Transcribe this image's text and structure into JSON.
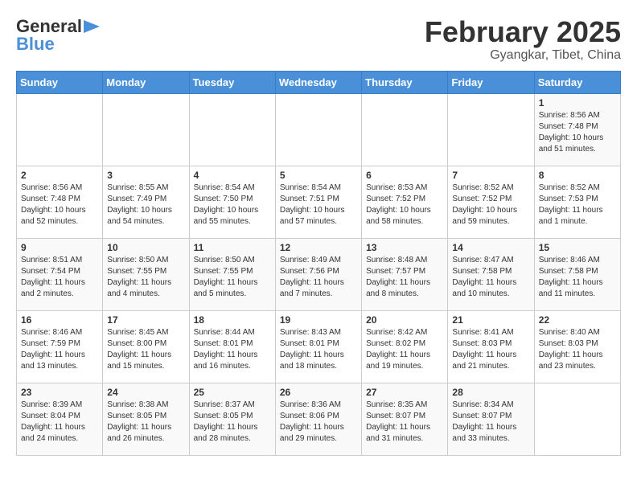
{
  "logo": {
    "text1": "General",
    "text2": "Blue"
  },
  "header": {
    "month": "February 2025",
    "location": "Gyangkar, Tibet, China"
  },
  "weekdays": [
    "Sunday",
    "Monday",
    "Tuesday",
    "Wednesday",
    "Thursday",
    "Friday",
    "Saturday"
  ],
  "weeks": [
    [
      {
        "day": "",
        "info": ""
      },
      {
        "day": "",
        "info": ""
      },
      {
        "day": "",
        "info": ""
      },
      {
        "day": "",
        "info": ""
      },
      {
        "day": "",
        "info": ""
      },
      {
        "day": "",
        "info": ""
      },
      {
        "day": "1",
        "info": "Sunrise: 8:56 AM\nSunset: 7:48 PM\nDaylight: 10 hours\nand 51 minutes."
      }
    ],
    [
      {
        "day": "2",
        "info": "Sunrise: 8:56 AM\nSunset: 7:48 PM\nDaylight: 10 hours\nand 52 minutes."
      },
      {
        "day": "3",
        "info": "Sunrise: 8:55 AM\nSunset: 7:49 PM\nDaylight: 10 hours\nand 54 minutes."
      },
      {
        "day": "4",
        "info": "Sunrise: 8:54 AM\nSunset: 7:50 PM\nDaylight: 10 hours\nand 55 minutes."
      },
      {
        "day": "5",
        "info": "Sunrise: 8:54 AM\nSunset: 7:51 PM\nDaylight: 10 hours\nand 57 minutes."
      },
      {
        "day": "6",
        "info": "Sunrise: 8:53 AM\nSunset: 7:52 PM\nDaylight: 10 hours\nand 58 minutes."
      },
      {
        "day": "7",
        "info": "Sunrise: 8:52 AM\nSunset: 7:52 PM\nDaylight: 10 hours\nand 59 minutes."
      },
      {
        "day": "8",
        "info": "Sunrise: 8:52 AM\nSunset: 7:53 PM\nDaylight: 11 hours\nand 1 minute."
      }
    ],
    [
      {
        "day": "9",
        "info": "Sunrise: 8:51 AM\nSunset: 7:54 PM\nDaylight: 11 hours\nand 2 minutes."
      },
      {
        "day": "10",
        "info": "Sunrise: 8:50 AM\nSunset: 7:55 PM\nDaylight: 11 hours\nand 4 minutes."
      },
      {
        "day": "11",
        "info": "Sunrise: 8:50 AM\nSunset: 7:55 PM\nDaylight: 11 hours\nand 5 minutes."
      },
      {
        "day": "12",
        "info": "Sunrise: 8:49 AM\nSunset: 7:56 PM\nDaylight: 11 hours\nand 7 minutes."
      },
      {
        "day": "13",
        "info": "Sunrise: 8:48 AM\nSunset: 7:57 PM\nDaylight: 11 hours\nand 8 minutes."
      },
      {
        "day": "14",
        "info": "Sunrise: 8:47 AM\nSunset: 7:58 PM\nDaylight: 11 hours\nand 10 minutes."
      },
      {
        "day": "15",
        "info": "Sunrise: 8:46 AM\nSunset: 7:58 PM\nDaylight: 11 hours\nand 11 minutes."
      }
    ],
    [
      {
        "day": "16",
        "info": "Sunrise: 8:46 AM\nSunset: 7:59 PM\nDaylight: 11 hours\nand 13 minutes."
      },
      {
        "day": "17",
        "info": "Sunrise: 8:45 AM\nSunset: 8:00 PM\nDaylight: 11 hours\nand 15 minutes."
      },
      {
        "day": "18",
        "info": "Sunrise: 8:44 AM\nSunset: 8:01 PM\nDaylight: 11 hours\nand 16 minutes."
      },
      {
        "day": "19",
        "info": "Sunrise: 8:43 AM\nSunset: 8:01 PM\nDaylight: 11 hours\nand 18 minutes."
      },
      {
        "day": "20",
        "info": "Sunrise: 8:42 AM\nSunset: 8:02 PM\nDaylight: 11 hours\nand 19 minutes."
      },
      {
        "day": "21",
        "info": "Sunrise: 8:41 AM\nSunset: 8:03 PM\nDaylight: 11 hours\nand 21 minutes."
      },
      {
        "day": "22",
        "info": "Sunrise: 8:40 AM\nSunset: 8:03 PM\nDaylight: 11 hours\nand 23 minutes."
      }
    ],
    [
      {
        "day": "23",
        "info": "Sunrise: 8:39 AM\nSunset: 8:04 PM\nDaylight: 11 hours\nand 24 minutes."
      },
      {
        "day": "24",
        "info": "Sunrise: 8:38 AM\nSunset: 8:05 PM\nDaylight: 11 hours\nand 26 minutes."
      },
      {
        "day": "25",
        "info": "Sunrise: 8:37 AM\nSunset: 8:05 PM\nDaylight: 11 hours\nand 28 minutes."
      },
      {
        "day": "26",
        "info": "Sunrise: 8:36 AM\nSunset: 8:06 PM\nDaylight: 11 hours\nand 29 minutes."
      },
      {
        "day": "27",
        "info": "Sunrise: 8:35 AM\nSunset: 8:07 PM\nDaylight: 11 hours\nand 31 minutes."
      },
      {
        "day": "28",
        "info": "Sunrise: 8:34 AM\nSunset: 8:07 PM\nDaylight: 11 hours\nand 33 minutes."
      },
      {
        "day": "",
        "info": ""
      }
    ]
  ]
}
